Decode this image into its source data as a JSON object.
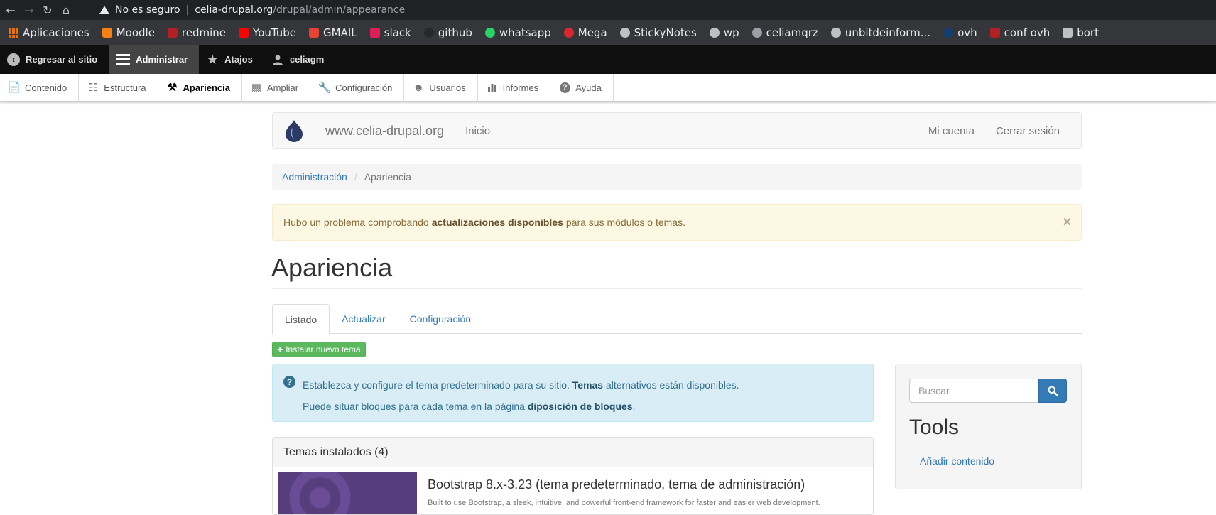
{
  "browser": {
    "insecure_label": "No es seguro",
    "url_host": "celia-drupal.org",
    "url_path": "/drupal/admin/appearance"
  },
  "bookmarks": [
    {
      "label": "Aplicaciones",
      "icon": "apps-grid-icon",
      "color": "#e37400"
    },
    {
      "label": "Moodle",
      "icon": "moodle-icon",
      "color": "#f98012"
    },
    {
      "label": "redmine",
      "icon": "redmine-icon",
      "color": "#b32024"
    },
    {
      "label": "YouTube",
      "icon": "youtube-icon",
      "color": "#ff0000"
    },
    {
      "label": "GMAIL",
      "icon": "gmail-icon",
      "color": "#ea4335"
    },
    {
      "label": "slack",
      "icon": "slack-icon",
      "color": "#e01e5a"
    },
    {
      "label": "github",
      "icon": "github-icon",
      "color": "#24292e"
    },
    {
      "label": "whatsapp",
      "icon": "whatsapp-icon",
      "color": "#25d366"
    },
    {
      "label": "Mega",
      "icon": "mega-icon",
      "color": "#d9272e"
    },
    {
      "label": "StickyNotes",
      "icon": "globe-icon",
      "color": "#bdc1c6"
    },
    {
      "label": "wp",
      "icon": "globe-icon",
      "color": "#bdc1c6"
    },
    {
      "label": "celiamqrz",
      "icon": "wordpress-icon",
      "color": "#9aa0a6"
    },
    {
      "label": "unbitdeinform...",
      "icon": "globe-icon",
      "color": "#bdc1c6"
    },
    {
      "label": "ovh",
      "icon": "ovh-icon",
      "color": "#123f6d"
    },
    {
      "label": "conf ovh",
      "icon": "redmine-icon",
      "color": "#b32024"
    },
    {
      "label": "bort",
      "icon": "folder-icon",
      "color": "#bdc1c6"
    }
  ],
  "toolbar": {
    "back_label": "Regresar al sitio",
    "admin_label": "Administrar",
    "shortcuts_label": "Atajos",
    "user_label": "celiagm"
  },
  "tray": [
    {
      "label": "Contenido",
      "icon": "file-icon"
    },
    {
      "label": "Estructura",
      "icon": "sitemap-icon"
    },
    {
      "label": "Apariencia",
      "icon": "hammer-icon",
      "active": true
    },
    {
      "label": "Ampliar",
      "icon": "puzzle-icon"
    },
    {
      "label": "Configuración",
      "icon": "wrench-icon"
    },
    {
      "label": "Usuarios",
      "icon": "people-icon"
    },
    {
      "label": "Informes",
      "icon": "bar-chart-icon"
    },
    {
      "label": "Ayuda",
      "icon": "help-icon"
    }
  ],
  "navbar": {
    "site_name": "www.celia-drupal.org",
    "home_link": "Inicio",
    "account_link": "Mi cuenta",
    "logout_link": "Cerrar sesión"
  },
  "breadcrumb": {
    "parent": "Administración",
    "current": "Apariencia"
  },
  "warning": {
    "prefix": "Hubo un problema comprobando",
    "link": "actualizaciones disponibles",
    "suffix": "para sus módulos o temas.",
    "close": "×"
  },
  "page_title": "Apariencia",
  "tabs": [
    {
      "label": "Listado",
      "active": true
    },
    {
      "label": "Actualizar"
    },
    {
      "label": "Configuración"
    }
  ],
  "install_button": "Instalar nuevo tema",
  "info": {
    "line1_prefix": "Establezca y configure el tema predeterminado para su sitio.",
    "line1_bold": "Temas",
    "line1_suffix": "alternativos están disponibles.",
    "line2_prefix": "Puede situar bloques para cada tema en la página",
    "line2_bold": "diposición de bloques",
    "line2_suffix": "."
  },
  "installed": {
    "heading": "Temas instalados (4)",
    "theme_name": "Bootstrap 8.x-3.23 (tema predeterminado, tema de administración)",
    "theme_desc": "Built to use Bootstrap, a sleek, intuitive, and powerful front-end framework for faster and easier web development."
  },
  "sidebar": {
    "search_placeholder": "Buscar",
    "tools_title": "Tools",
    "tools_link": "Añadir contenido"
  }
}
